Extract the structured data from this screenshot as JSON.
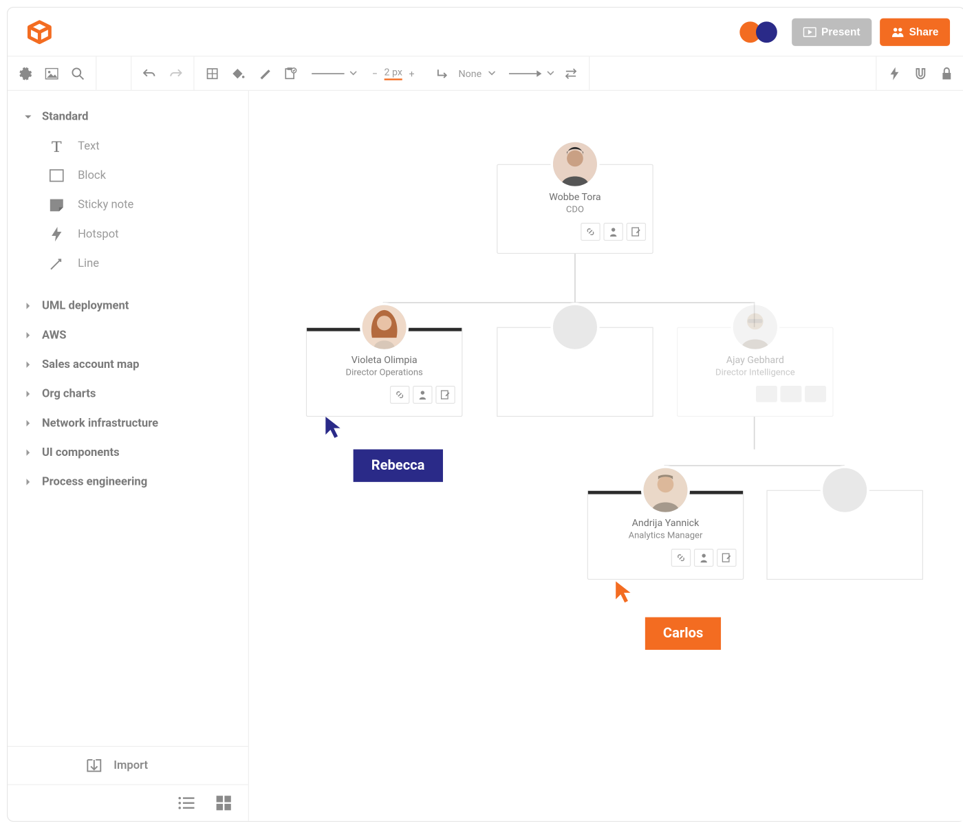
{
  "header": {
    "present_label": "Present",
    "share_label": "Share",
    "presence_colors": [
      "#F36C21",
      "#2a2a88"
    ]
  },
  "toolbar": {
    "stroke_value": "2",
    "stroke_unit": "px",
    "corner_label": "None"
  },
  "sidebar": {
    "categories": [
      {
        "label": "Standard",
        "expanded": true
      },
      {
        "label": "UML deployment",
        "expanded": false
      },
      {
        "label": "AWS",
        "expanded": false
      },
      {
        "label": "Sales account map",
        "expanded": false
      },
      {
        "label": "Org charts",
        "expanded": false
      },
      {
        "label": "Network infrastructure",
        "expanded": false
      },
      {
        "label": "UI components",
        "expanded": false
      },
      {
        "label": "Process engineering",
        "expanded": false
      }
    ],
    "standard_shapes": [
      {
        "label": "Text"
      },
      {
        "label": "Block"
      },
      {
        "label": "Sticky note"
      },
      {
        "label": "Hotspot"
      },
      {
        "label": "Line"
      }
    ],
    "import_label": "Import"
  },
  "canvas": {
    "nodes": {
      "root": {
        "name": "Wobbe Tora",
        "title": "CDO"
      },
      "left": {
        "name": "Violeta Olimpia",
        "title": "Director Operations"
      },
      "right": {
        "name": "Ajay Gebhard",
        "title": "Director Intelligence"
      },
      "bottom": {
        "name": "Andrija Yannick",
        "title": "Analytics Manager"
      }
    },
    "cursors": {
      "rebecca": {
        "label": "Rebecca",
        "color": "#2a2a88"
      },
      "carlos": {
        "label": "Carlos",
        "color": "#F36C21"
      }
    }
  }
}
